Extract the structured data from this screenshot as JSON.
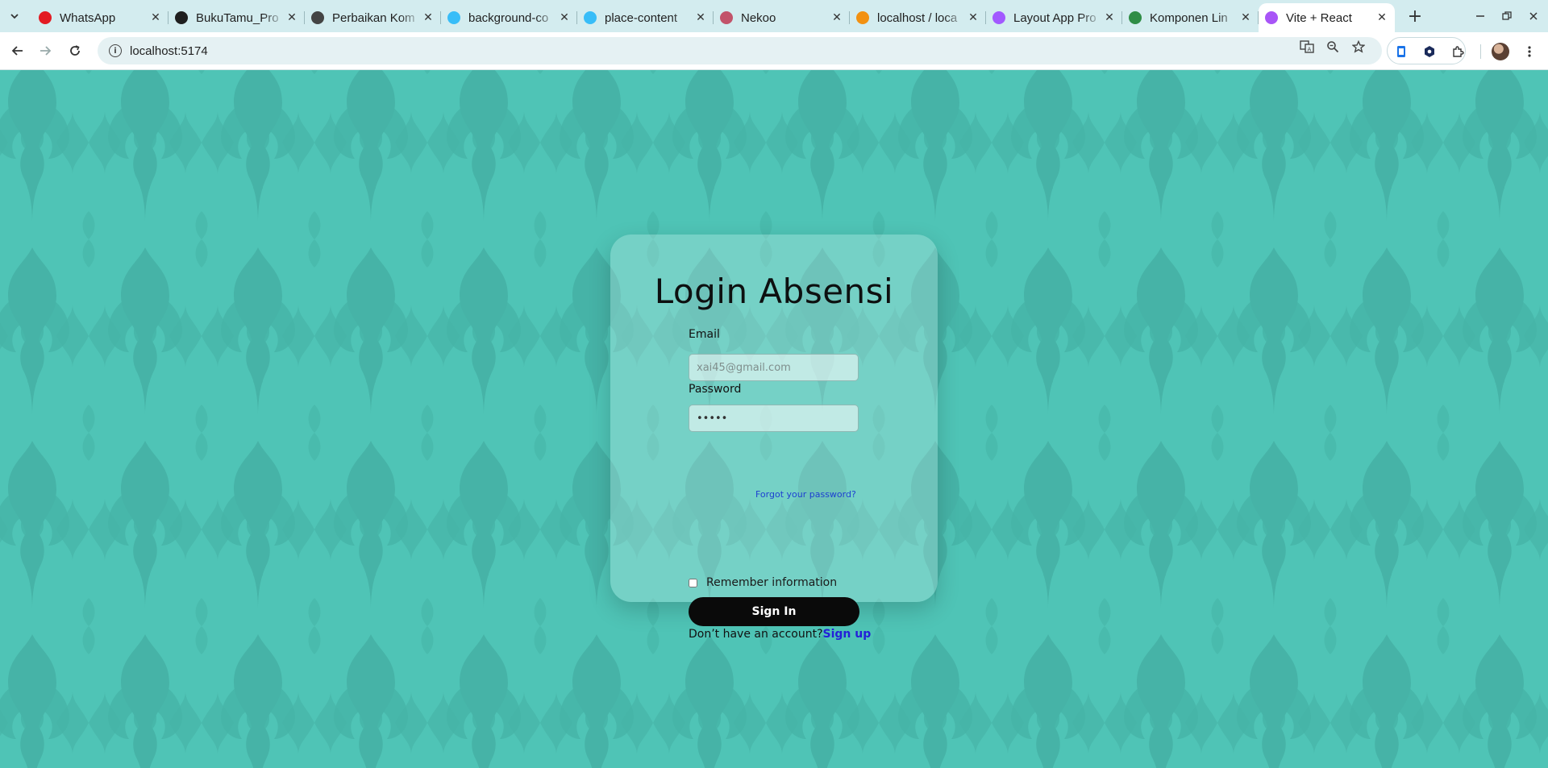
{
  "browser": {
    "tabs": [
      {
        "title": "WhatsApp",
        "favicon": "whatsapp-alert-icon",
        "color": "#e31b23"
      },
      {
        "title": "BukuTamu_Pro",
        "favicon": "github-icon",
        "color": "#1f1f1f"
      },
      {
        "title": "Perbaikan Kom",
        "favicon": "openai-icon",
        "color": "#444444"
      },
      {
        "title": "background-co",
        "favicon": "tailwind-icon",
        "color": "#38bdf8"
      },
      {
        "title": "place-content",
        "favicon": "tailwind-icon",
        "color": "#38bdf8"
      },
      {
        "title": "Nekoo",
        "favicon": "cat-icon",
        "color": "#c2536a"
      },
      {
        "title": "localhost / loca",
        "favicon": "phpmyadmin-icon",
        "color": "#f29111"
      },
      {
        "title": "Layout App Pro",
        "favicon": "figma-icon",
        "color": "#a259ff"
      },
      {
        "title": "Komponen Lin",
        "favicon": "geeksforgeeks-icon",
        "color": "#2f8d46"
      },
      {
        "title": "Vite + React",
        "favicon": "vite-icon",
        "color": "#a855f7"
      }
    ],
    "active_tab_index": 9,
    "url": "localhost:5174"
  },
  "login": {
    "title": "Login Absensi",
    "email_label": "Email",
    "email_placeholder": "xai45@gmail.com",
    "password_label": "Password",
    "forgot_link": "Forgot your password?",
    "password_value": "•••••",
    "remember_label": "Remember information",
    "remember_checked": false,
    "signin_label": "Sign In",
    "no_account_text": "Don’t have an account?",
    "signup_link": "Sign up"
  },
  "colors": {
    "page_background": "#4fc4b6",
    "pattern": "#45b3a6",
    "button": "#0a0a0a",
    "link": "#2420d8"
  }
}
